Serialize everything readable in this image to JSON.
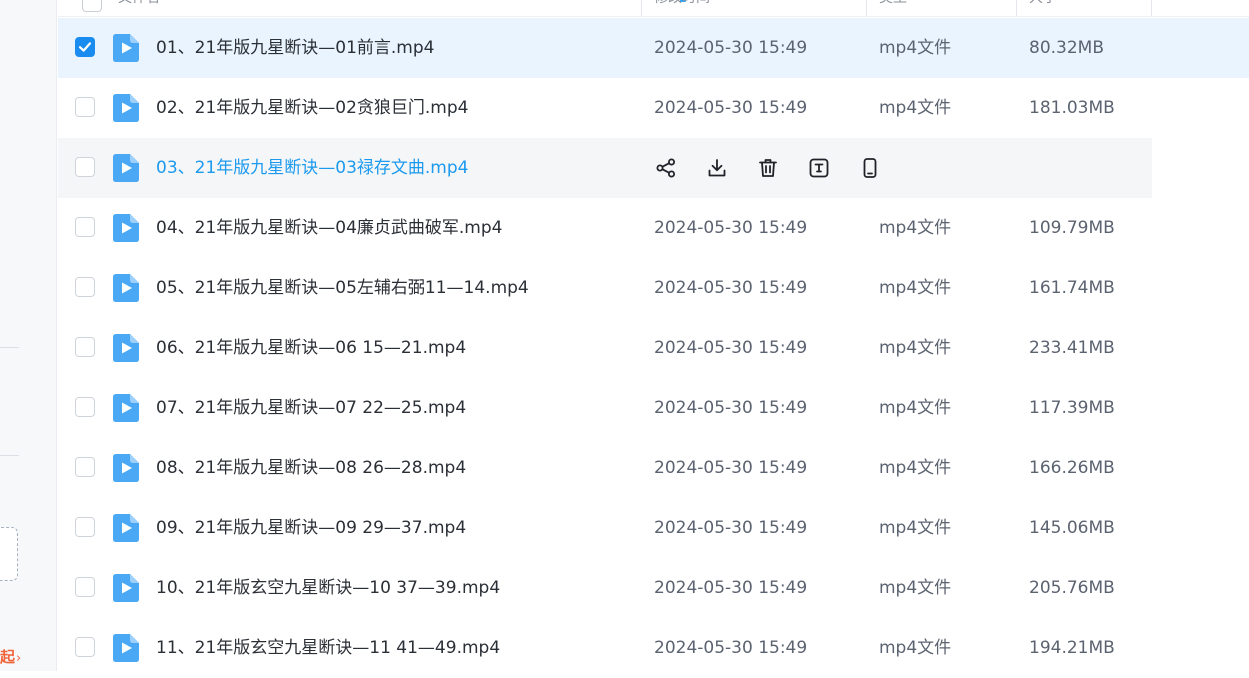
{
  "header": {
    "name_col": "文件名",
    "modified_col": "修改时间",
    "type_col": "类型",
    "size_col": "大小"
  },
  "sidebar": {
    "collapse_label": "起",
    "collapse_chevron": "›"
  },
  "colors": {
    "accent": "#1a8cf0",
    "selected_row": "#e9f4fe",
    "hover_row": "#f5f6f8",
    "hover_text": "#1b9aee",
    "file_icon": "#4aa8f5"
  },
  "icons": {
    "file": "video-file-icon",
    "actions": [
      "share-icon",
      "download-icon",
      "delete-icon",
      "rename-icon",
      "phone-icon"
    ]
  },
  "files": [
    {
      "name": "01、21年版九星断诀—01前言.mp4",
      "modified": "2024-05-30 15:49",
      "type": "mp4文件",
      "size": "80.32MB",
      "checked": true
    },
    {
      "name": "02、21年版九星断诀—02贪狼巨门.mp4",
      "modified": "2024-05-30 15:49",
      "type": "mp4文件",
      "size": "181.03MB",
      "checked": false
    },
    {
      "name": "03、21年版九星断诀—03禄存文曲.mp4",
      "modified": "",
      "type": "",
      "size": "",
      "checked": false,
      "hovered": true
    },
    {
      "name": "04、21年版九星断诀—04廉贞武曲破军.mp4",
      "modified": "2024-05-30 15:49",
      "type": "mp4文件",
      "size": "109.79MB",
      "checked": false
    },
    {
      "name": "05、21年版九星断诀—05左辅右弼11—14.mp4",
      "modified": "2024-05-30 15:49",
      "type": "mp4文件",
      "size": "161.74MB",
      "checked": false
    },
    {
      "name": "06、21年版九星断诀—06 15—21.mp4",
      "modified": "2024-05-30 15:49",
      "type": "mp4文件",
      "size": "233.41MB",
      "checked": false
    },
    {
      "name": "07、21年版九星断诀—07 22—25.mp4",
      "modified": "2024-05-30 15:49",
      "type": "mp4文件",
      "size": "117.39MB",
      "checked": false
    },
    {
      "name": "08、21年版九星断诀—08 26—28.mp4",
      "modified": "2024-05-30 15:49",
      "type": "mp4文件",
      "size": "166.26MB",
      "checked": false
    },
    {
      "name": "09、21年版九星断诀—09 29—37.mp4",
      "modified": "2024-05-30 15:49",
      "type": "mp4文件",
      "size": "145.06MB",
      "checked": false
    },
    {
      "name": "10、21年版玄空九星断诀—10 37—39.mp4",
      "modified": "2024-05-30 15:49",
      "type": "mp4文件",
      "size": "205.76MB",
      "checked": false
    },
    {
      "name": "11、21年版玄空九星断诀—11 41—49.mp4",
      "modified": "2024-05-30 15:49",
      "type": "mp4文件",
      "size": "194.21MB",
      "checked": false
    }
  ]
}
